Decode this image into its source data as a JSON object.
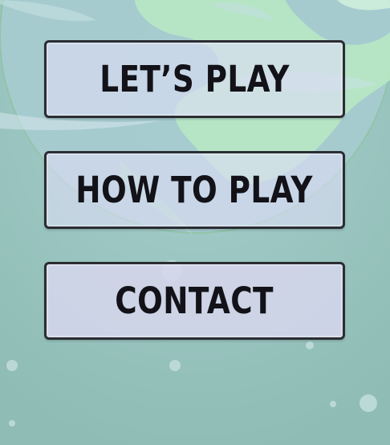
{
  "menu": {
    "items": [
      {
        "label": "LET’S PLAY"
      },
      {
        "label": "HOW TO PLAY"
      },
      {
        "label": "CONTACT"
      }
    ]
  },
  "colors": {
    "background": "#9cc5c0",
    "planet": "#bcecc8",
    "button_fill": "#dcdcf4",
    "button_border": "#2b2d33",
    "label": "#121218"
  }
}
